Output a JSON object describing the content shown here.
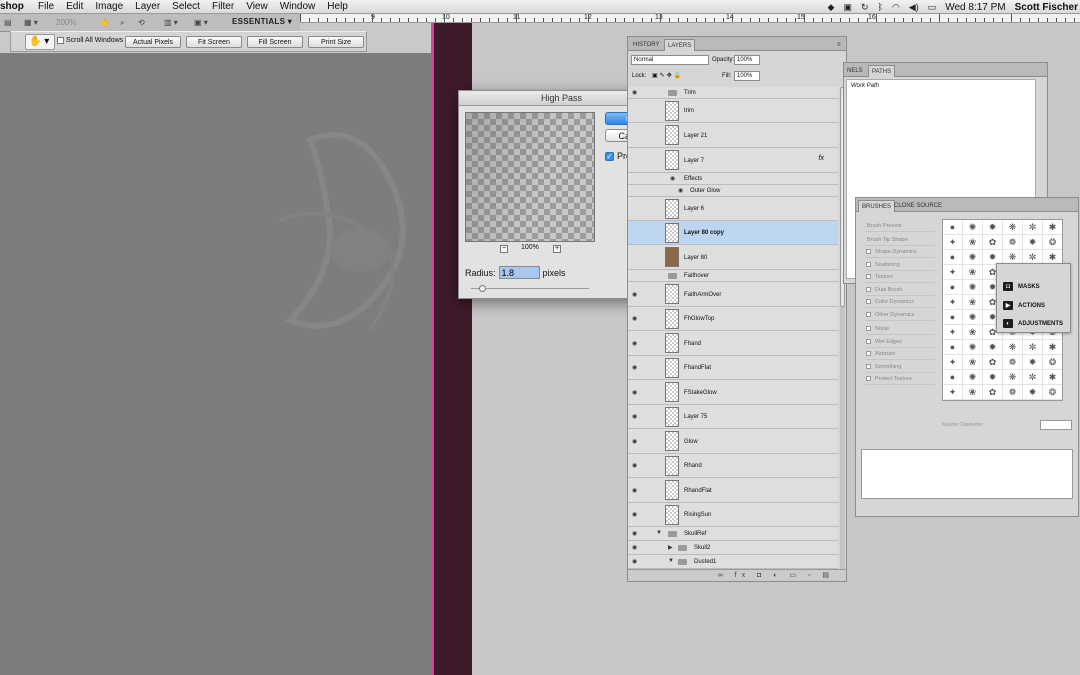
{
  "menubar": {
    "app": "shop",
    "menus": [
      "File",
      "Edit",
      "Image",
      "Layer",
      "Select",
      "Filter",
      "View",
      "Window",
      "Help"
    ],
    "clock": "Wed 8:17 PM",
    "user": "Scott Fischer"
  },
  "ruler": {
    "numbers": [
      "9",
      "10",
      "11",
      "12",
      "13",
      "14",
      "15",
      "16"
    ]
  },
  "appbar": {
    "zoom": "200%",
    "workspace": "ESSENTIALS ▾"
  },
  "options": {
    "scroll_all": "Scroll All Windows",
    "actual_pixels": "Actual Pixels",
    "fit_screen": "Fit Screen",
    "fill_screen": "Fill Screen",
    "print_size": "Print Size"
  },
  "dialog": {
    "title": "High Pass",
    "ok": "OK",
    "cancel": "Cancel",
    "preview": "Preview",
    "preview_checked": true,
    "zoom": "100%",
    "radius_label": "Radius:",
    "radius_value": "1.8",
    "radius_unit": "pixels"
  },
  "layers_panel": {
    "tabs": [
      "HISTORY",
      "LAYERS"
    ],
    "blend": "Normal",
    "opacity_label": "Opacity:",
    "opacity": "100%",
    "lock_label": "Lock:",
    "fill_label": "Fill:",
    "fill": "100%",
    "rows": [
      {
        "name": "Trim",
        "kind": "folder"
      },
      {
        "name": "trim",
        "kind": "layer"
      },
      {
        "name": "Layer 21",
        "kind": "layer"
      },
      {
        "name": "Layer 7",
        "kind": "layer",
        "fx": "fx"
      },
      {
        "name": "Effects",
        "kind": "sub"
      },
      {
        "name": "Outer Glow",
        "kind": "sub2"
      },
      {
        "name": "Layer 6",
        "kind": "layer"
      },
      {
        "name": "Layer 80 copy",
        "kind": "layer",
        "selected": true
      },
      {
        "name": "Layer 80",
        "kind": "layer"
      },
      {
        "name": "Faithover",
        "kind": "folder"
      },
      {
        "name": "FaithArmOver",
        "kind": "layer"
      },
      {
        "name": "FhGlowTop",
        "kind": "layer"
      },
      {
        "name": "Fhand",
        "kind": "layer"
      },
      {
        "name": "FhandFlat",
        "kind": "layer"
      },
      {
        "name": "FStakeGlow",
        "kind": "layer"
      },
      {
        "name": "Layer 75",
        "kind": "layer"
      },
      {
        "name": "Glow",
        "kind": "layer"
      },
      {
        "name": "Rhand",
        "kind": "layer"
      },
      {
        "name": "RhandFlat",
        "kind": "layer"
      },
      {
        "name": "RisingSun",
        "kind": "layer"
      },
      {
        "name": "SkullRef",
        "kind": "folder"
      },
      {
        "name": "Skull2",
        "kind": "folder"
      },
      {
        "name": "Dusted1",
        "kind": "folder"
      }
    ],
    "footer": "∞ fx ◘ ◐ ▭ ▫ ▤"
  },
  "paths_panel": {
    "tabs": [
      "NELS",
      "PATHS"
    ],
    "item": "Work Path"
  },
  "brushes_panel": {
    "tabs": [
      "BRUSHES",
      "CLONE SOURCE"
    ],
    "options": [
      "Brush Presets",
      "Brush Tip Shape",
      "Shape Dynamics",
      "Scattering",
      "Texture",
      "Dual Brush",
      "Color Dynamics",
      "Other Dynamics",
      "Noise",
      "Wet Edges",
      "Airbrush",
      "Smoothing",
      "Protect Texture"
    ],
    "master_diameter": "Master Diameter"
  },
  "masks_panel": {
    "items": [
      "MASKS",
      "ACTIONS",
      "ADJUSTMENTS"
    ]
  }
}
